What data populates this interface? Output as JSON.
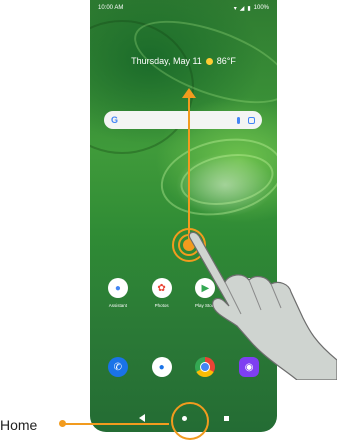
{
  "status_bar": {
    "time": "10:00 AM",
    "battery": "100%"
  },
  "at_a_glance": {
    "date": "Thursday, May 11",
    "temperature": "86°F"
  },
  "search": {
    "logo": "G",
    "mic_icon": "mic-icon",
    "lens_icon": "lens-icon"
  },
  "apps_row1": [
    {
      "label": "Assistant",
      "icon": "assistant-icon",
      "color": "#4285F4"
    },
    {
      "label": "Photos",
      "icon": "photos-icon",
      "color": "#EA4335"
    },
    {
      "label": "Play Store",
      "icon": "play-store-icon",
      "color": "#34A853"
    },
    {
      "label": "Google",
      "icon": "google-icon",
      "color": "#FBBC05"
    }
  ],
  "dock": [
    {
      "icon": "phone-icon",
      "color": "#1a73e8"
    },
    {
      "icon": "messages-icon",
      "color": "#1a73e8"
    },
    {
      "icon": "chrome-icon",
      "color": "#EA4335"
    },
    {
      "icon": "camera-icon",
      "color": "#7e3ff2"
    }
  ],
  "annotation": {
    "label": "Home"
  },
  "colors": {
    "accent": "#f29b1e",
    "wallpaper": "#2f8b35"
  }
}
